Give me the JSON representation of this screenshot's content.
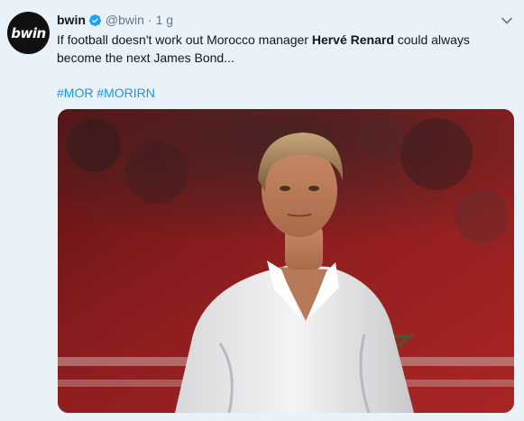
{
  "tweet": {
    "avatar_label": "bwin",
    "display_name": "bwin",
    "handle": "@bwin",
    "separator": "·",
    "time": "1 g",
    "text_part1": "If football doesn't work out Morocco manager ",
    "text_bold": "Hervé Renard",
    "text_part2": " could always become the next James Bond...",
    "hashtags": [
      "#MOR",
      "#MORIRN"
    ]
  },
  "icons": {
    "verified": "verified-badge-icon",
    "caret": "chevron-down-icon"
  },
  "colors": {
    "background": "#e9f2f9",
    "link": "#1b95e0",
    "verified": "#1da1f2",
    "meta": "#657786"
  }
}
